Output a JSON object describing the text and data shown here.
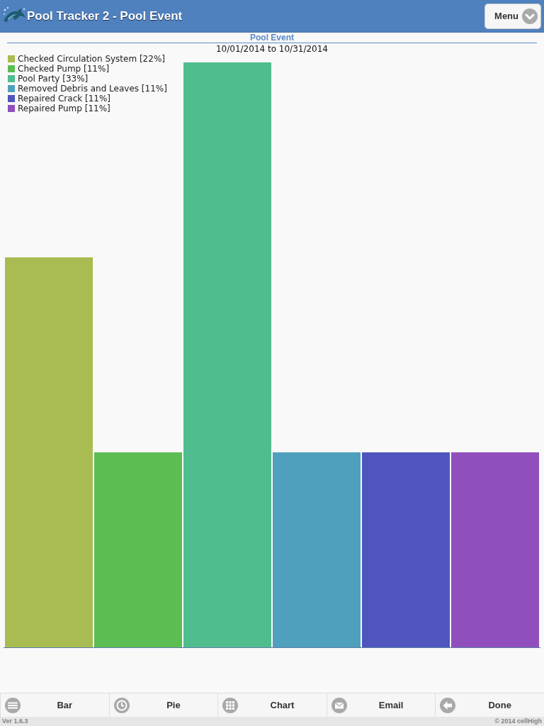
{
  "header": {
    "title": "Pool Tracker 2 - Pool Event",
    "menu_button": "Menu"
  },
  "chart": {
    "title": "Pool Event",
    "date_range": "10/01/2014 to 10/31/2014",
    "legend_items": [
      {
        "label": "Checked Circulation System [22%]",
        "color": "#a9bc52"
      },
      {
        "label": "Checked Pump [11%]",
        "color": "#5bbd52"
      },
      {
        "label": "Pool Party [33%]",
        "color": "#50bd8f"
      },
      {
        "label": "Removed Debris and Leaves [11%]",
        "color": "#4fa0bd"
      },
      {
        "label": "Repaired Crack [11%]",
        "color": "#4f55bd"
      },
      {
        "label": "Repaired Pump [11%]",
        "color": "#914fbd"
      }
    ]
  },
  "toolbar": [
    "Bar",
    "Pie",
    "Chart",
    "Email",
    "Done"
  ],
  "footer": {
    "version": "Ver 1.6.3",
    "copyright": "© 2014 cellHigh"
  }
}
